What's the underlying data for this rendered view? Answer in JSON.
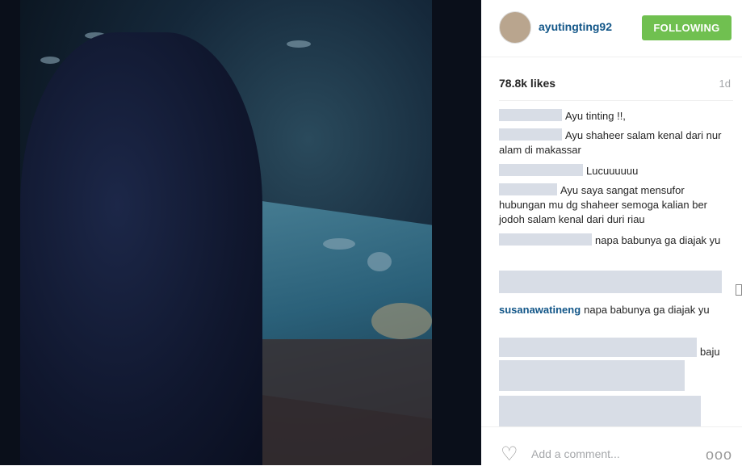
{
  "post": {
    "username": "ayutingting92",
    "follow_label": "FOLLOWING",
    "likes": "78.8k likes",
    "age": "1d"
  },
  "comments": [
    {
      "user": "",
      "text": "Ayu tinting !!,"
    },
    {
      "user": "",
      "text": "Ayu shaheer salam kenal dari nur alam di makassar"
    },
    {
      "user": "",
      "text": "Lucuuuuuu"
    },
    {
      "user": "",
      "text": "Ayu saya sangat mensufor hubungan mu dg shaheer semoga kalian ber jodoh salam kenal dari duri riau"
    },
    {
      "user": "",
      "text": "napa babunya ga diajak yu"
    },
    {
      "user": "susanawatineng",
      "text": "napa babunya ga diajak yu"
    },
    {
      "user": "",
      "text": "baju"
    }
  ],
  "footer": {
    "add_comment_placeholder": "Add a comment...",
    "more_label": "ooo"
  },
  "colors": {
    "follow_bg": "#70c050",
    "username": "#125688"
  }
}
